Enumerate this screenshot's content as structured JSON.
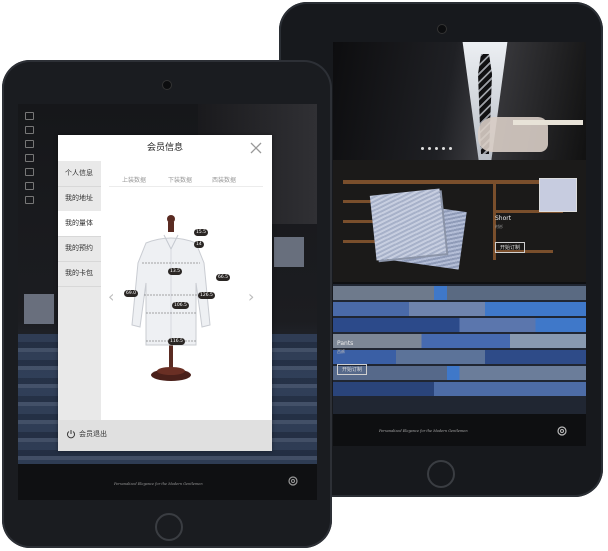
{
  "modal": {
    "title": "会员信息",
    "sidebar": [
      "个人信息",
      "我的地址",
      "我的量体",
      "我的预约",
      "我的卡包"
    ],
    "active_index": 2,
    "tabs": [
      "上装数据",
      "下装数据",
      "西装数据"
    ],
    "logout": "会员退出",
    "measurements": [
      "15.5",
      "14",
      "13.5",
      "69.0",
      "66.5",
      "106.5",
      "126.5",
      "116.5"
    ]
  },
  "back_screen": {
    "product_short": "Short",
    "product_short_sub": "衬衫",
    "product_pants": "Pants",
    "product_pants_sub": "西裤",
    "button_label": "开始订制",
    "footer_text": "Personalized Elegance for the Modern Gentlemen"
  },
  "front_screen": {
    "footer_text": "Personalized Elegance for the Modern Gentlemen"
  },
  "colors": {
    "accent_blue": "#3f78c9",
    "wood": "#7a4f2c",
    "modal_bg": "#ffffff"
  },
  "icons": [
    "close-icon",
    "power-icon",
    "gear-icon",
    "arrow-left-icon",
    "arrow-right-icon"
  ]
}
